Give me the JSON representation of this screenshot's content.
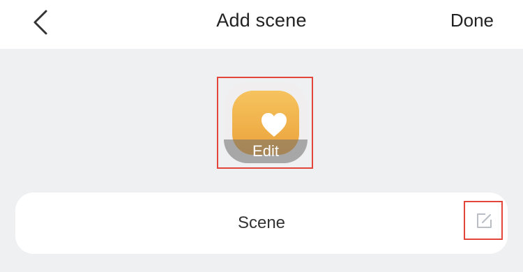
{
  "header": {
    "title": "Add scene",
    "done_label": "Done"
  },
  "scene_icon": {
    "edit_label": "Edit",
    "icon": "heart-icon",
    "gradient_colors": [
      "#f6c35e",
      "#eba23b"
    ]
  },
  "scene_name": {
    "value": "Scene"
  },
  "icons": {
    "back": "chevron-left-icon",
    "edit": "edit-icon"
  },
  "colors": {
    "highlight_border": "#e2463b",
    "background": "#eff0f2"
  }
}
